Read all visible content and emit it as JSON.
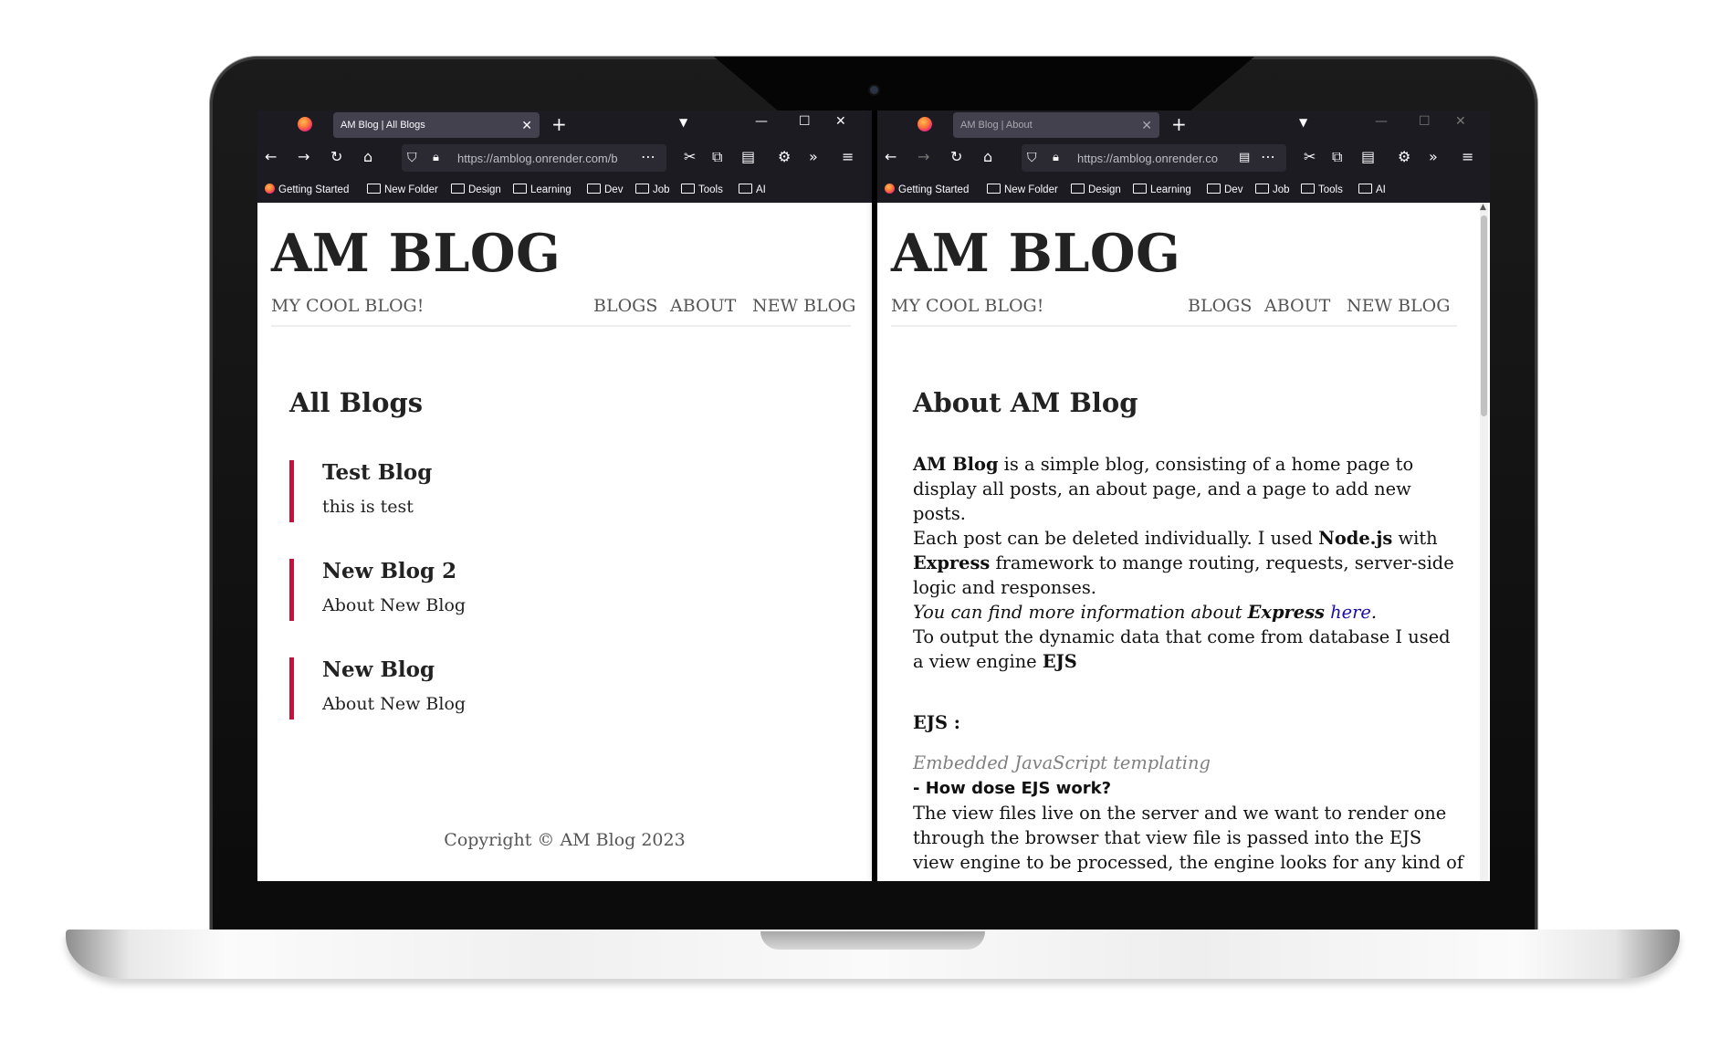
{
  "left_window": {
    "tab_title": "AM Blog | All Blogs",
    "url": "https://amblog.onrender.com/b",
    "bookmarks": [
      "Getting Started",
      "New Folder",
      "Design",
      "Learning",
      "Dev",
      "Job",
      "Tools",
      "AI"
    ],
    "site": {
      "title": "AM BLOG",
      "tagline": "MY COOL BLOG!",
      "nav": [
        "BLOGS",
        "ABOUT",
        "NEW BLOG"
      ]
    },
    "heading": "All Blogs",
    "posts": [
      {
        "title": "Test Blog",
        "snippet": "this is test"
      },
      {
        "title": "New Blog 2",
        "snippet": "About New Blog"
      },
      {
        "title": "New Blog",
        "snippet": "About New Blog"
      }
    ],
    "footer": "Copyright © AM Blog 2023"
  },
  "right_window": {
    "tab_title": "AM Blog | About",
    "url": "https://amblog.onrender.co",
    "bookmarks": [
      "Getting Started",
      "New Folder",
      "Design",
      "Learning",
      "Dev",
      "Job",
      "Tools",
      "AI"
    ],
    "site": {
      "title": "AM BLOG",
      "tagline": "MY COOL BLOG!",
      "nav": [
        "BLOGS",
        "ABOUT",
        "NEW BLOG"
      ]
    },
    "heading": "About AM Blog",
    "about": {
      "p1_bold": "AM Blog",
      "p1_rest": " is a simple blog, consisting of a home page to display all posts, an about page, and a page to add new posts.",
      "p2_a": "Each post can be deleted individually. I used ",
      "p2_node": "Node.js",
      "p2_b": " with ",
      "p2_express": "Express",
      "p2_c": " framework to mange routing, requests, server-side logic and responses.",
      "p3_a": "You can find more information about ",
      "p3_express": "Express",
      "p3_link": "here",
      "p3_dot": ".",
      "p4_a": "To output the dynamic data that come from database I used a view engine ",
      "p4_ejs": "EJS",
      "ejs_label": "EJS :",
      "ejs_sub": "Embedded JavaScript templating",
      "ejs_q": "- How dose EJS work?",
      "ejs_body": "The view files live on the server and we want to render one through the browser that view file is passed into the EJS view engine to be processed, the engine looks for any kind of"
    }
  },
  "colors": {
    "accent_border": "#c3133a",
    "chrome_bg": "#1c1b22",
    "link": "#1a0dab"
  }
}
